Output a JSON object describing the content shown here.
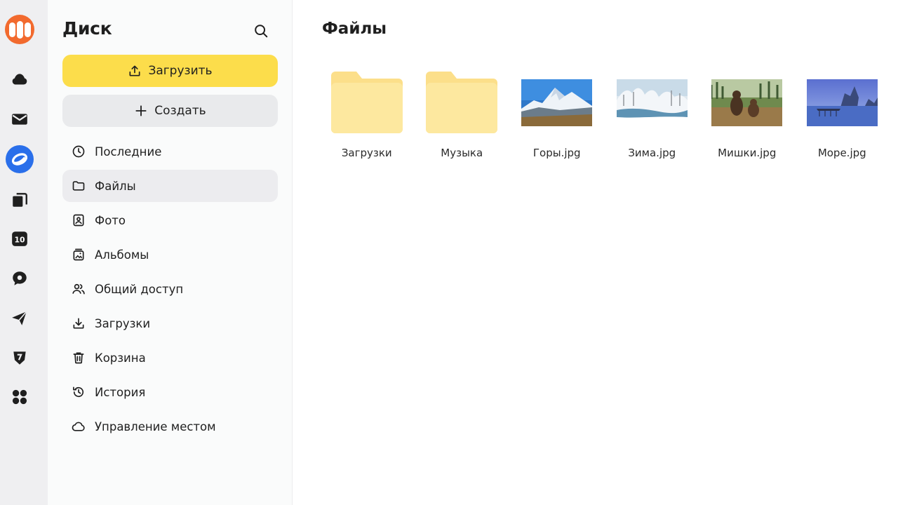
{
  "rail": {
    "items": [
      {
        "name": "cloud-icon"
      },
      {
        "name": "mail-icon"
      },
      {
        "name": "disk-icon"
      },
      {
        "name": "documents-icon"
      },
      {
        "name": "calendar-icon",
        "text": "10"
      },
      {
        "name": "messenger-icon"
      },
      {
        "name": "send-icon"
      },
      {
        "name": "shield-icon"
      },
      {
        "name": "apps-grid-icon"
      }
    ]
  },
  "sidebar": {
    "title": "Диск",
    "upload_label": "Загрузить",
    "create_label": "Создать",
    "nav": [
      {
        "label": "Последние",
        "icon": "clock-icon"
      },
      {
        "label": "Файлы",
        "icon": "folder-icon",
        "active": true
      },
      {
        "label": "Фото",
        "icon": "photo-icon"
      },
      {
        "label": "Альбомы",
        "icon": "albums-icon"
      },
      {
        "label": "Общий доступ",
        "icon": "people-icon"
      },
      {
        "label": "Загрузки",
        "icon": "download-icon"
      },
      {
        "label": "Корзина",
        "icon": "trash-icon"
      },
      {
        "label": "История",
        "icon": "history-icon"
      },
      {
        "label": "Управление местом",
        "icon": "cloud-outline-icon"
      }
    ]
  },
  "main": {
    "title": "Файлы",
    "items": [
      {
        "label": "Загрузки",
        "kind": "folder"
      },
      {
        "label": "Музыка",
        "kind": "folder"
      },
      {
        "label": "Горы.jpg",
        "kind": "image",
        "thumb": "mountains"
      },
      {
        "label": "Зима.jpg",
        "kind": "image",
        "thumb": "winter"
      },
      {
        "label": "Мишки.jpg",
        "kind": "image",
        "thumb": "bears"
      },
      {
        "label": "Море.jpg",
        "kind": "image",
        "thumb": "sea"
      }
    ]
  },
  "colors": {
    "accent_yellow": "#fcdd4b",
    "logo_orange": "#f26a2e",
    "disk_blue": "#2a6fea",
    "folder": "#fde69a"
  }
}
